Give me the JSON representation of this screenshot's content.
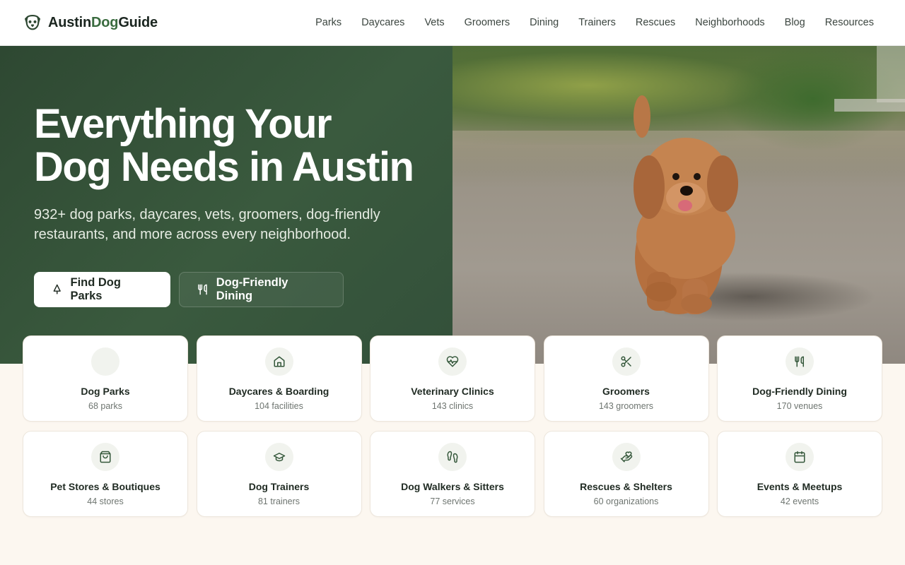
{
  "brand": {
    "name_part1": "Austin",
    "name_part2": "Dog",
    "name_part3": "Guide",
    "logo_icon": "dog-face-icon"
  },
  "nav": [
    "Parks",
    "Daycares",
    "Vets",
    "Groomers",
    "Dining",
    "Trainers",
    "Rescues",
    "Neighborhoods",
    "Blog",
    "Resources"
  ],
  "hero": {
    "title_line1": "Everything Your",
    "title_line2": "Dog Needs in Austin",
    "subtitle": "932+ dog parks, daycares, vets, groomers, dog-friendly restaurants, and more across every neighborhood.",
    "primary_button": "Find Dog Parks",
    "primary_icon": "tree-icon",
    "secondary_button": "Dog-Friendly Dining",
    "secondary_icon": "utensils-icon"
  },
  "categories": [
    {
      "title": "Dog Parks",
      "count": "68 parks",
      "icon": "none"
    },
    {
      "title": "Daycares & Boarding",
      "count": "104 facilities",
      "icon": "home-icon"
    },
    {
      "title": "Veterinary Clinics",
      "count": "143 clinics",
      "icon": "heart-pulse-icon"
    },
    {
      "title": "Groomers",
      "count": "143 groomers",
      "icon": "scissors-icon"
    },
    {
      "title": "Dog-Friendly Dining",
      "count": "170 venues",
      "icon": "utensils-icon"
    },
    {
      "title": "Pet Stores & Boutiques",
      "count": "44 stores",
      "icon": "shopping-bag-icon"
    },
    {
      "title": "Dog Trainers",
      "count": "81 trainers",
      "icon": "graduation-cap-icon"
    },
    {
      "title": "Dog Walkers & Sitters",
      "count": "77 services",
      "icon": "footprints-icon"
    },
    {
      "title": "Rescues & Shelters",
      "count": "60 organizations",
      "icon": "hand-heart-icon"
    },
    {
      "title": "Events & Meetups",
      "count": "42 events",
      "icon": "calendar-icon"
    }
  ],
  "colors": {
    "hero_green": "#2e4832",
    "accent": "#3a6b3f",
    "page_bg": "#fcf7f0"
  }
}
